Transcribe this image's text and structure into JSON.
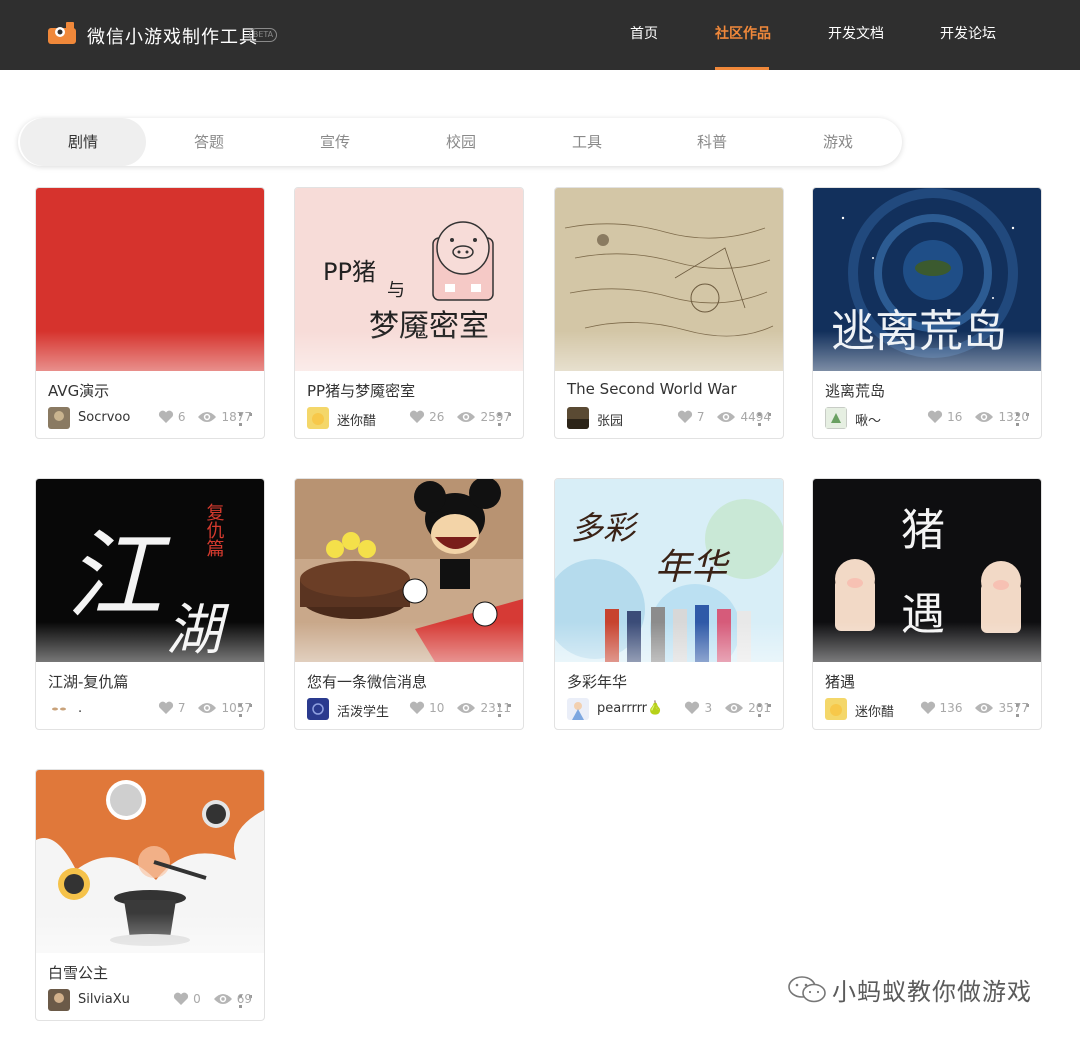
{
  "header": {
    "app_title": "微信小游戏制作工具",
    "badge": "BETA",
    "nav": [
      {
        "label": "首页"
      },
      {
        "label": "社区作品"
      },
      {
        "label": "开发文档"
      },
      {
        "label": "开发论坛"
      }
    ],
    "active_nav": "社区作品",
    "accent_color": "#f0883a",
    "bar_color": "#2f2f2f"
  },
  "tabs": [
    {
      "label": "剧情"
    },
    {
      "label": "答题"
    },
    {
      "label": "宣传"
    },
    {
      "label": "校园"
    },
    {
      "label": "工具"
    },
    {
      "label": "科普"
    },
    {
      "label": "游戏"
    }
  ],
  "active_tab": "剧情",
  "cards": [
    {
      "title": "AVG演示",
      "author": "Socrvoo",
      "likes": "6",
      "views": "1877"
    },
    {
      "title": "PP猪与梦魇密室",
      "author": "迷你醋",
      "likes": "26",
      "views": "2597",
      "cover_text": [
        "PP猪",
        "与",
        "梦魇密室"
      ]
    },
    {
      "title": "The Second World War",
      "author": "张园",
      "likes": "7",
      "views": "4494"
    },
    {
      "title": "逃离荒岛",
      "author": "啾～",
      "likes": "16",
      "views": "1320",
      "cover_text": [
        "逃离荒岛"
      ]
    },
    {
      "title": "江湖-复仇篇",
      "author": ".",
      "likes": "7",
      "views": "1057",
      "cover_text": [
        "江",
        "湖",
        "复仇篇"
      ]
    },
    {
      "title": "您有一条微信消息",
      "author": "活泼学生",
      "likes": "10",
      "views": "2311"
    },
    {
      "title": "多彩年华",
      "author": "pearrrrr🍐",
      "likes": "3",
      "views": "201",
      "cover_text": [
        "多彩",
        "年华"
      ]
    },
    {
      "title": "猪遇",
      "author": "迷你醋",
      "likes": "136",
      "views": "3577",
      "cover_text": [
        "猪",
        "遇"
      ]
    },
    {
      "title": "白雪公主",
      "author": "SilviaXu",
      "likes": "0",
      "views": "69"
    }
  ],
  "watermark": "小蚂蚁教你做游戏",
  "icons": {
    "like": "heart-icon",
    "views": "eye-icon",
    "qr": "qr-code-icon"
  }
}
